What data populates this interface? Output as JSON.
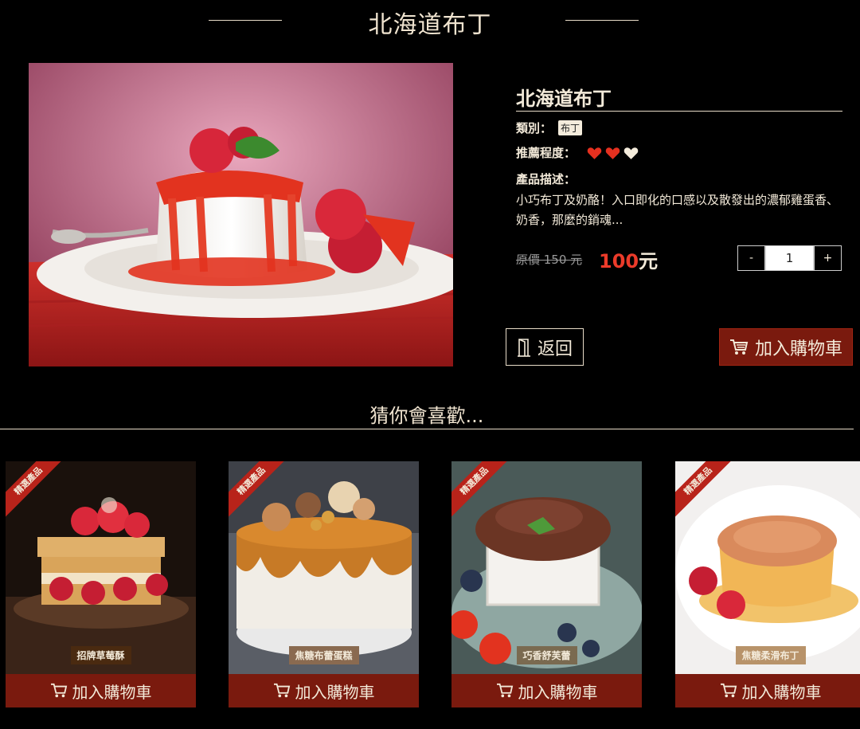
{
  "header": {
    "title": "北海道布丁"
  },
  "product": {
    "name": "北海道布丁",
    "category_label": "類別：",
    "category_value": "布丁",
    "rating_label": "推薦程度：",
    "rating": {
      "filled": 2,
      "total": 3,
      "filled_color": "#e5301f",
      "empty_color": "#f4ecdc"
    },
    "desc_label": "產品描述：",
    "description": "小巧布丁及奶酪！入口即化的口感以及散發出的濃郁雞蛋香、奶香，那麼的銷魂...",
    "original_price": "原價 150 元",
    "sale_price": "100",
    "sale_unit": "元",
    "quantity": "1",
    "qty_minus": "-",
    "qty_plus": "+",
    "back_label": "返回",
    "add_cart_label": "加入購物車"
  },
  "recommend": {
    "title": "猜你會喜歡...",
    "ribbon_text": "精選產品",
    "items": [
      {
        "name": "招牌草莓酥",
        "cart_label": "加入購物車"
      },
      {
        "name": "焦糖布蕾蛋糕",
        "cart_label": "加入購物車"
      },
      {
        "name": "巧香舒芙蕾",
        "cart_label": "加入購物車"
      },
      {
        "name": "焦糖柔滑布丁",
        "cart_label": "加入購物車"
      }
    ]
  },
  "colors": {
    "accent": "#7a1a0e",
    "sale": "#ec3b2a",
    "text": "#f3ead9",
    "ribbon": "#b8231a"
  }
}
